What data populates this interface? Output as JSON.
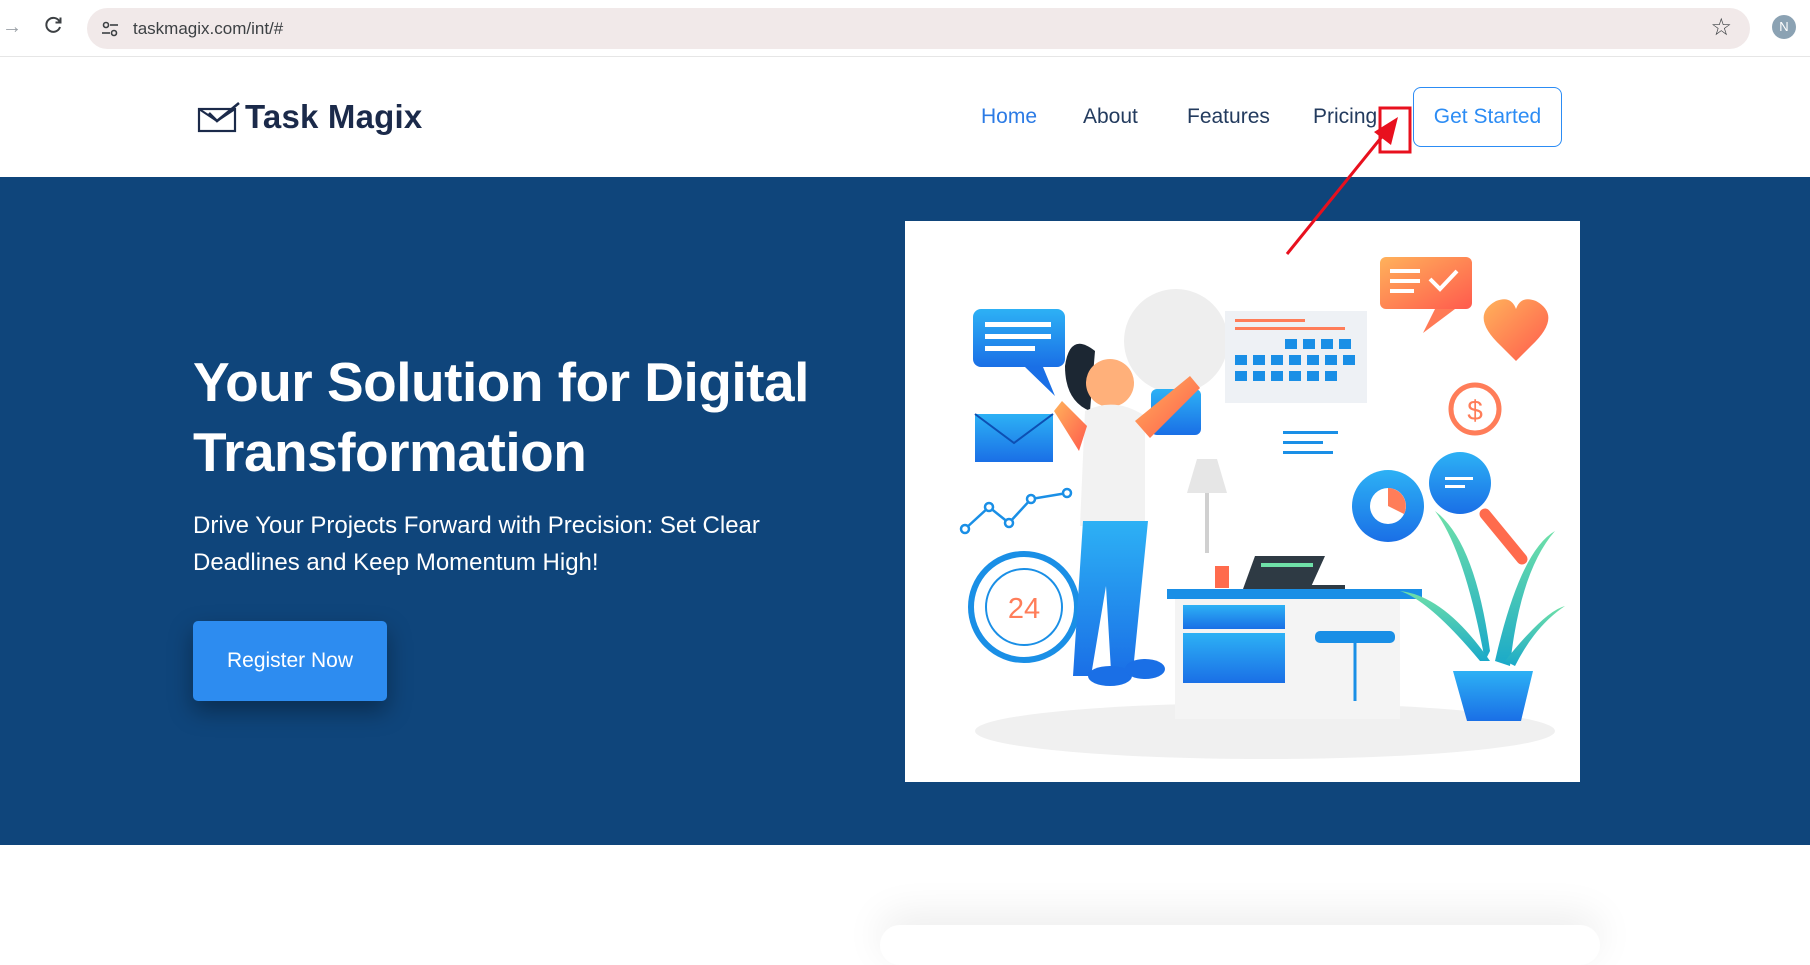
{
  "browser": {
    "url": "taskmagix.com/int/#",
    "avatar_initial": "N",
    "icons": [
      "forward-arrow-icon",
      "reload-icon",
      "site-info-icon",
      "bookmark-star-icon"
    ]
  },
  "header": {
    "brand": "Task Magix",
    "nav": [
      {
        "label": "Home",
        "active": true
      },
      {
        "label": "About",
        "active": false
      },
      {
        "label": "Features",
        "active": false
      },
      {
        "label": "Pricing",
        "active": false
      }
    ],
    "cta": "Get Started"
  },
  "hero": {
    "title": "Your Solution for Digital Transformation",
    "subtitle": "Drive Your Projects Forward with Precision: Set Clear Deadlines and Keep Momentum High!",
    "button": "Register Now",
    "illustration_counter": "24"
  },
  "colors": {
    "hero_bg": "#0f457b",
    "accent": "#2c8cf4",
    "brand_text": "#1b2a4a",
    "annotation": "#e8101e"
  }
}
